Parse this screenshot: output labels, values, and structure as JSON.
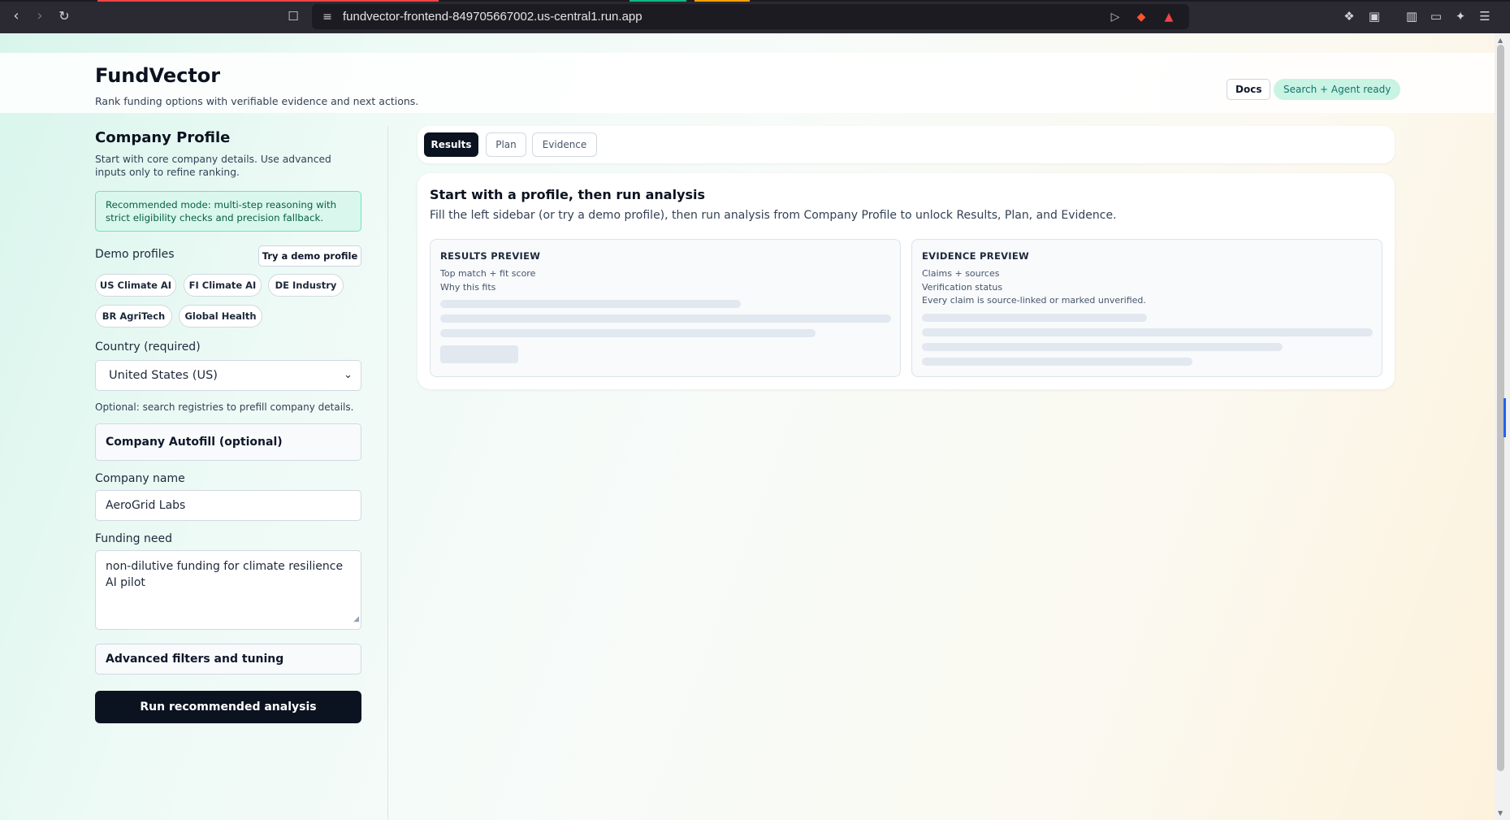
{
  "browser": {
    "url": "fundvector-frontend-849705667002.us-central1.run.app"
  },
  "header": {
    "title": "FundVector",
    "subtitle": "Rank funding options with verifiable evidence and next actions.",
    "docs_label": "Docs",
    "status_badge": "Search + Agent ready"
  },
  "sidebar": {
    "title": "Company Profile",
    "subtitle": "Start with core company details. Use advanced inputs only to refine ranking.",
    "recommendation": "Recommended mode: multi-step reasoning with strict eligibility checks and precision fallback.",
    "demo_label": "Demo profiles",
    "demo_button": "Try a demo profile",
    "demo_chips": [
      "US Climate AI",
      "FI Climate AI",
      "DE Industry",
      "BR AgriTech",
      "Global Health"
    ],
    "country_label": "Country (required)",
    "country_value": "United States (US)",
    "optional_note": "Optional: search registries to prefill company details.",
    "autofill_label": "Company Autofill (optional)",
    "company_name_label": "Company name",
    "company_name_value": "AeroGrid Labs",
    "funding_need_label": "Funding need",
    "funding_need_value": "non-dilutive funding for climate resilience AI pilot",
    "advanced_label": "Advanced filters and tuning",
    "run_button": "Run recommended analysis"
  },
  "main": {
    "tabs": [
      {
        "label": "Results",
        "active": true
      },
      {
        "label": "Plan",
        "active": false
      },
      {
        "label": "Evidence",
        "active": false
      }
    ],
    "title": "Start with a profile, then run analysis",
    "description": "Fill the left sidebar (or try a demo profile), then run analysis from Company Profile to unlock Results, Plan, and Evidence.",
    "results_preview": {
      "heading": "RESULTS PREVIEW",
      "lines": [
        "Top match + fit score",
        "Why this fits"
      ]
    },
    "evidence_preview": {
      "heading": "EVIDENCE PREVIEW",
      "lines": [
        "Claims + sources",
        "Verification status",
        "Every claim is source-linked or marked unverified."
      ]
    }
  },
  "colors": {
    "primary": "#0b1220",
    "accent_badge": "#c9f3e3",
    "recommend_border": "#6ee7b7"
  }
}
